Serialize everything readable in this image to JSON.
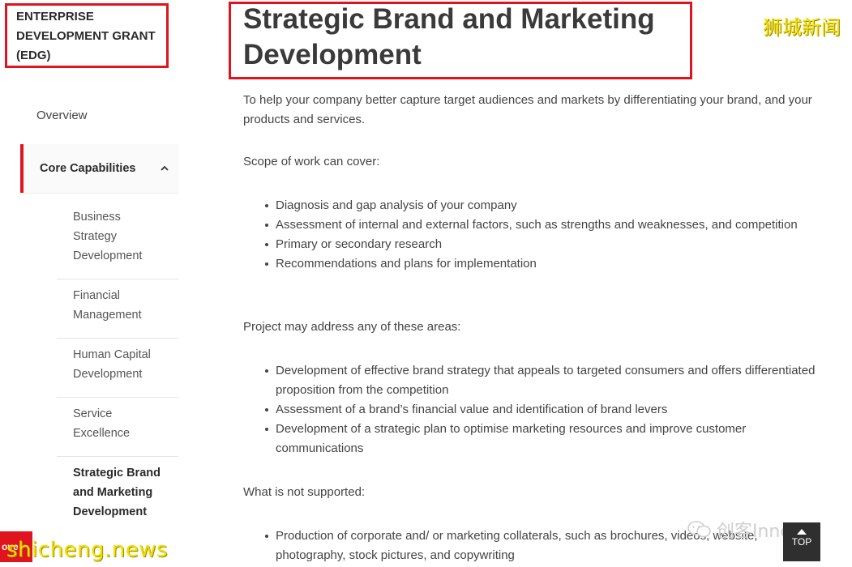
{
  "sidebar": {
    "grant_title_lines": [
      "ENTERPRISE",
      "DEVELOPMENT GRANT",
      "(EDG)"
    ],
    "overview_label": "Overview",
    "core_label": "Core Capabilities",
    "sub_items": [
      {
        "label_lines": [
          "Business",
          "Strategy",
          "Development"
        ]
      },
      {
        "label_lines": [
          "Financial",
          "Management"
        ]
      },
      {
        "label_lines": [
          "Human Capital",
          "Development"
        ]
      },
      {
        "label_lines": [
          "Service",
          "Excellence"
        ]
      },
      {
        "label_lines": [
          "Strategic Brand",
          "and Marketing",
          "Development"
        ]
      }
    ]
  },
  "main": {
    "title_lines": [
      "Strategic Brand and Marketing",
      "Development"
    ],
    "intro": "To help your company better capture target audiences and markets by differentiating your brand, and your products and services.",
    "scope_heading": "Scope of work can cover:",
    "scope_items": [
      "Diagnosis and gap analysis of your company",
      "Assessment of internal and external factors, such as strengths and weaknesses, and competition",
      "Primary or secondary research",
      "Recommendations and plans for implementation"
    ],
    "areas_heading": "Project may address any of these areas:",
    "areas_items": [
      "Development of effective brand strategy that appeals to targeted consumers and offers differentiated proposition from the competition",
      "Assessment of a brand’s financial value and identification of brand levers",
      "Development of a strategic plan to optimise marketing resources and improve customer communications"
    ],
    "not_supported_heading": "What is not supported:",
    "not_supported_items": [
      "Production of corporate and/ or marketing collaterals, such as brochures, videos, website, photography, stock pictures, and copywriting"
    ]
  },
  "overlays": {
    "watermark_top": "狮城新闻",
    "watermark_bottom": "shicheng.news",
    "wechat_text": "创客InnoE",
    "red_badge_text": "ove",
    "top_button_label": "TOP"
  },
  "colors": {
    "accent_red": "#e0141e",
    "watermark_yellow": "#f4e000"
  }
}
